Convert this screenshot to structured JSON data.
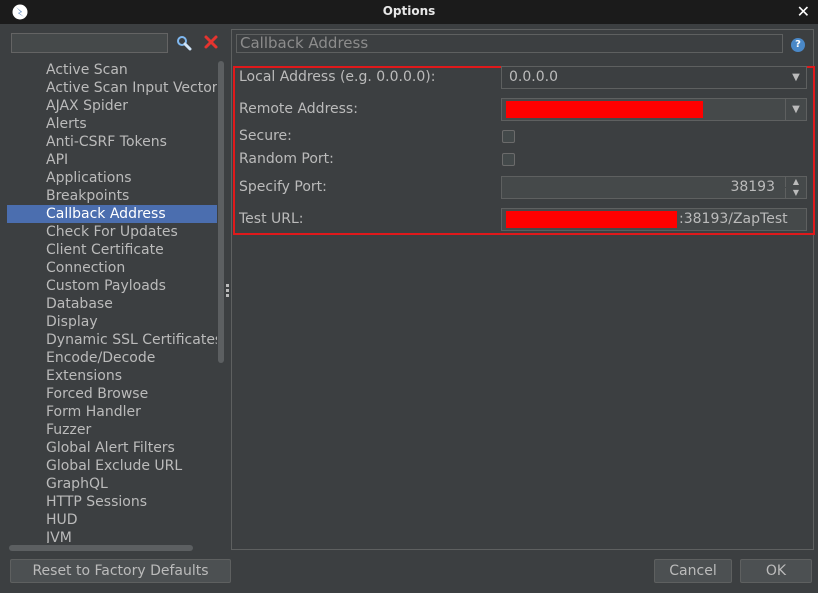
{
  "window": {
    "title": "Options"
  },
  "search": {
    "value": ""
  },
  "tree": {
    "items": [
      "Active Scan",
      "Active Scan Input Vectors",
      "AJAX Spider",
      "Alerts",
      "Anti-CSRF Tokens",
      "API",
      "Applications",
      "Breakpoints",
      "Callback Address",
      "Check For Updates",
      "Client Certificate",
      "Connection",
      "Custom Payloads",
      "Database",
      "Display",
      "Dynamic SSL Certificates",
      "Encode/Decode",
      "Extensions",
      "Forced Browse",
      "Form Handler",
      "Fuzzer",
      "Global Alert Filters",
      "Global Exclude URL",
      "GraphQL",
      "HTTP Sessions",
      "HUD",
      "JVM"
    ],
    "selected": "Callback Address"
  },
  "panel": {
    "title": "Callback Address",
    "local_address_label": "Local Address (e.g. 0.0.0.0):",
    "local_address_value": "0.0.0.0",
    "remote_address_label": "Remote Address:",
    "secure_label": "Secure:",
    "random_port_label": "Random Port:",
    "specify_port_label": "Specify Port:",
    "specify_port_value": "38193",
    "test_url_label": "Test URL:",
    "test_url_suffix": ":38193/ZapTest"
  },
  "buttons": {
    "reset": "Reset to Factory Defaults",
    "cancel": "Cancel",
    "ok": "OK"
  },
  "colors": {
    "selection": "#4b6eaf",
    "highlight_border": "#e0191b",
    "redaction": "#ff0000"
  }
}
